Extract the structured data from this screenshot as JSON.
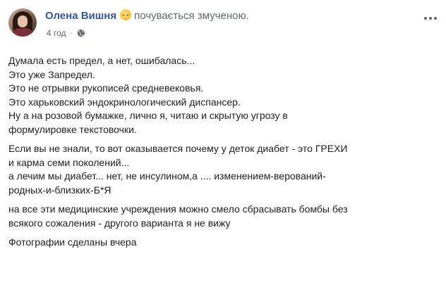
{
  "post": {
    "author": "Олена Вишня",
    "feeling": "почувається змученою.",
    "feeling_icon": "tired-face-emoji",
    "time": "4 год",
    "privacy_icon": "globe-icon",
    "paragraphs": [
      {
        "lines": [
          "Думала есть предел, а нет, ошибалась...",
          "Это уже Запредел.",
          "Это не отрывки рукописей средневековья.",
          "Это харьковский эндокринологический диспансер.",
          "Ну а на розовой бумажке, лично я, читаю и скрытую угрозу в",
          "формулировке текстовочки."
        ]
      },
      {
        "lines": [
          "Если вы не знали, то вот оказывается почему у деток диабет - это ГРЕХИ",
          "и карма семи поколений...",
          "а лечим мы диабет... нет, не инсулином,а .... изменением-верований-",
          "родных-и-близких-Б*Я"
        ]
      },
      {
        "lines": [
          "на все эти медицинские учреждения можно смело сбрасывать бомбы без",
          "всякого сожаления - другого варианта я не вижу"
        ]
      },
      {
        "lines": [
          "Фотографии сделаны вчера"
        ]
      }
    ]
  }
}
